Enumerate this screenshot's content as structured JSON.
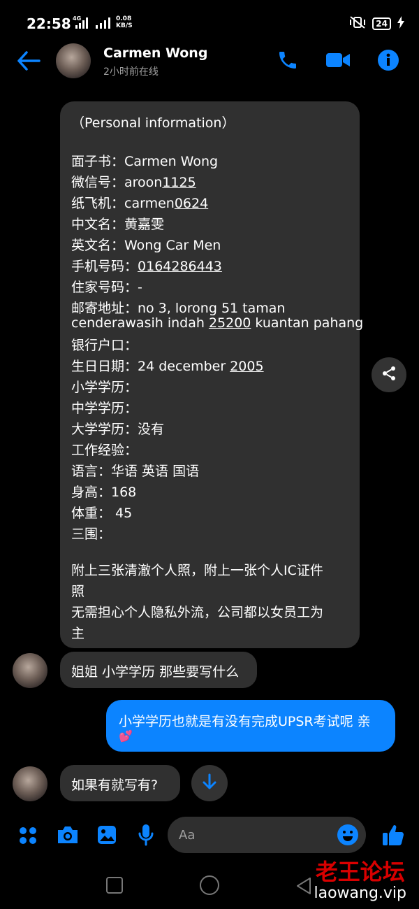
{
  "status_bar": {
    "time": "22:58",
    "network": "4G",
    "speed_value": "0.08",
    "speed_unit": "KB/S",
    "battery": "24"
  },
  "header": {
    "name": "Carmen Wong",
    "status": "2小时前在线"
  },
  "info_message": {
    "title": "（Personal information）",
    "lines": [
      "面子书：Carmen Wong",
      "微信号：aroon1125",
      "纸飞机：carmen0624",
      "中文名：黄嘉雯",
      "英文名：Wong Car Men",
      "手机号码：0164286443",
      "住家号码：-",
      "邮寄地址：no 3, lorong 51 taman",
      "cenderawasih indah 25200 kuantan pahang",
      "银行户口：",
      "生日日期：24 december 2005",
      "小学学历：",
      "中学学历：",
      "大学学历：没有",
      "工作经验：",
      "语言：华语 英语 国语",
      "身高：168",
      "体重： 45",
      "三围："
    ],
    "note_lines": [
      "附上三张清澈个人照，附上一张个人IC证件",
      "照",
      "无需担心个人隐私外流，公司都以女员工为",
      "主"
    ]
  },
  "messages": {
    "incoming_1": "姐姐 小学学历 那些要写什么",
    "outgoing_1": "小学学历也就是有没有完成UPSR考试呢 亲",
    "outgoing_1_emoji": "💕",
    "incoming_2": "如果有就写有?"
  },
  "composer": {
    "placeholder": "Aa"
  },
  "watermark": {
    "name": "老王论坛",
    "url": "laowang.vip"
  },
  "colors": {
    "accent": "#0c84ff",
    "bubble_in": "#303030",
    "background": "#000000",
    "watermark": "#d80000"
  }
}
